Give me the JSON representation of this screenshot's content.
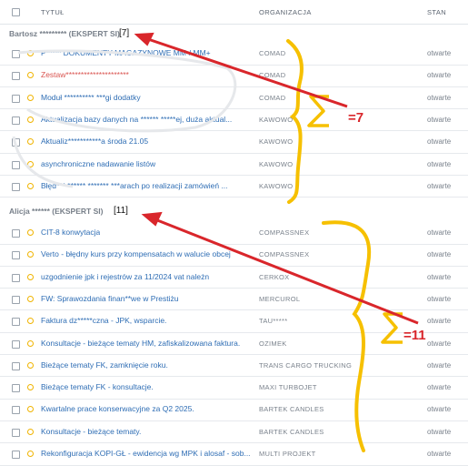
{
  "header": {
    "title_col": "TYTUŁ",
    "org_col": "ORGANIZACJA",
    "status_col": "STAN"
  },
  "groups": [
    {
      "name": "Bartosz ********* (EKSPERT SI)",
      "count": "[7]"
    },
    {
      "name": "Alicja ****** (EKSPERT SI)",
      "count": "[11]"
    }
  ],
  "rows_group1": [
    {
      "title": "P***** DOKUMENTY MAGAZYNOWE MM-/ MM+",
      "org": "COMAD",
      "status": "otwarte",
      "red": false
    },
    {
      "title": "Zestaw*********************",
      "org": "COMAD",
      "status": "otwarte",
      "red": true
    },
    {
      "title": "Moduł ********** ***gi dodatky",
      "org": "COMAD",
      "status": "otwarte",
      "red": false
    },
    {
      "title": "Aktualizacja bazy danych na ****** *****ej, duża aktual...",
      "org": "KAWOWO",
      "status": "otwarte",
      "red": false
    },
    {
      "title": "Aktualiz***********a środa 21.05",
      "org": "KAWOWO",
      "status": "otwarte",
      "red": false
    },
    {
      "title": "asynchroniczne nadawanie listów",
      "org": "KAWOWO",
      "status": "otwarte",
      "red": false
    },
    {
      "title": "Błęd*** ****** ******* ***arach po realizacji zamówień ...",
      "org": "KAWOWO",
      "status": "otwarte",
      "red": false
    }
  ],
  "rows_group2": [
    {
      "title": "CIT-8 konwytacja",
      "org": "COMPASSNEX",
      "status": "otwarte",
      "red": false
    },
    {
      "title": "Verto - błędny kurs przy kompensatach w walucie obcej",
      "org": "COMPASSNEX",
      "status": "otwarte",
      "red": false
    },
    {
      "title": "uzgodnienie jpk i rejestrów za 11/2024 vat należn",
      "org": "CERKOX",
      "status": "otwarte",
      "red": false
    },
    {
      "title": "FW: Sprawozdania finan**we w Prestiżu",
      "org": "MERCUROL",
      "status": "otwarte",
      "red": false
    },
    {
      "title": "Faktura dz*****czna - JPK, wsparcie.",
      "org": "TAU*****",
      "status": "otwarte",
      "red": false
    },
    {
      "title": "Konsultacje - bieżące tematy HM, zafiskalizowana faktura.",
      "org": "OZIMEK",
      "status": "otwarte",
      "red": false
    },
    {
      "title": "Bieżące tematy FK, zamknięcie roku.",
      "org": "TRANS CARGO TRUCKING",
      "status": "otwarte",
      "red": false
    },
    {
      "title": "Bieżące tematy FK - konsultacje.",
      "org": "MAXI TURBOJET",
      "status": "otwarte",
      "red": false
    },
    {
      "title": "Kwartalne prace konserwacyjne za Q2 2025.",
      "org": "BARTEK CANDLES",
      "status": "otwarte",
      "red": false
    },
    {
      "title": "Konsultacje - bieżące tematy.",
      "org": "BARTEK CANDLES",
      "status": "otwarte",
      "red": false
    },
    {
      "title": "Rekonfiguracja KOPI-GŁ - ewidencja wg MPK i alosaf - sob...",
      "org": "MULTI PROJEKT",
      "status": "otwarte",
      "red": false
    }
  ],
  "annotations": {
    "sum1": "=7",
    "sum2": "=11",
    "sigma": "Σ"
  },
  "colors": {
    "link": "#2e6db4",
    "red_arrow": "#d9262b",
    "yellow_brace": "#f6c000",
    "dot": "#f0b400"
  }
}
